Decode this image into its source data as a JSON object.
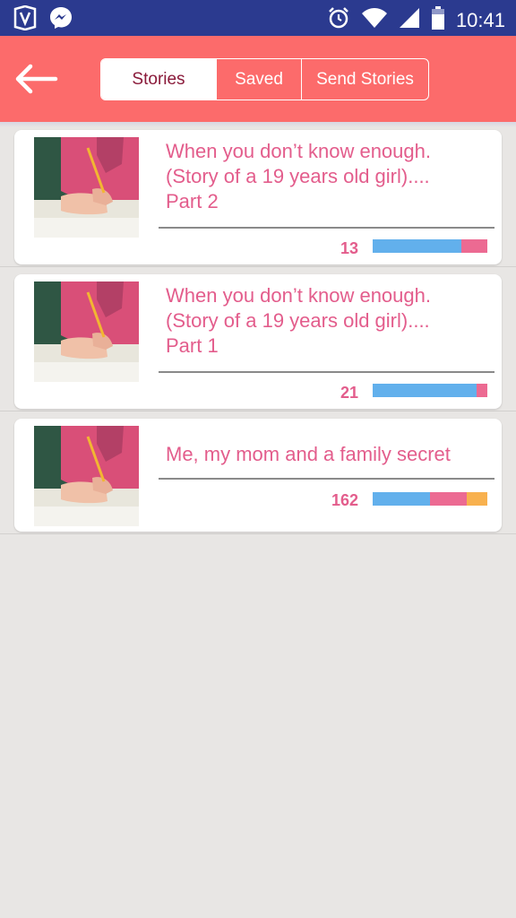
{
  "status_bar": {
    "time": "10:41",
    "icons": [
      "shield-app-icon",
      "messenger-icon",
      "alarm-icon",
      "wifi-icon",
      "signal-icon",
      "battery-icon"
    ]
  },
  "header": {
    "back_icon": "arrow-left-icon",
    "tabs": [
      {
        "label": "Stories",
        "active": true
      },
      {
        "label": "Saved",
        "active": false
      },
      {
        "label": "Send Stories",
        "active": false
      }
    ]
  },
  "stories": [
    {
      "title_lines": [
        "When you don’t know enough.",
        "(Story of a 19 years old girl)....",
        "Part 2"
      ],
      "count": "13",
      "rating_fractions": {
        "blue": 0.77,
        "pink": 0.23,
        "orange": 0.0
      }
    },
    {
      "title_lines": [
        "When you don’t know enough.",
        "(Story of a 19 years old girl)....",
        "Part 1"
      ],
      "count": "21",
      "rating_fractions": {
        "blue": 0.91,
        "pink": 0.09,
        "orange": 0.0
      }
    },
    {
      "title_lines": [
        "Me, my mom and a family secret"
      ],
      "count": "162",
      "rating_fractions": {
        "blue": 0.5,
        "pink": 0.32,
        "orange": 0.18
      }
    }
  ],
  "colors": {
    "status_bar": "#2b3a8f",
    "header": "#fc6b6b",
    "active_tab_text": "#8a1a3a",
    "title": "#e35d8c",
    "bar_blue": "#62b0ec",
    "bar_pink": "#ec6a92",
    "bar_orange": "#f8b14e"
  }
}
